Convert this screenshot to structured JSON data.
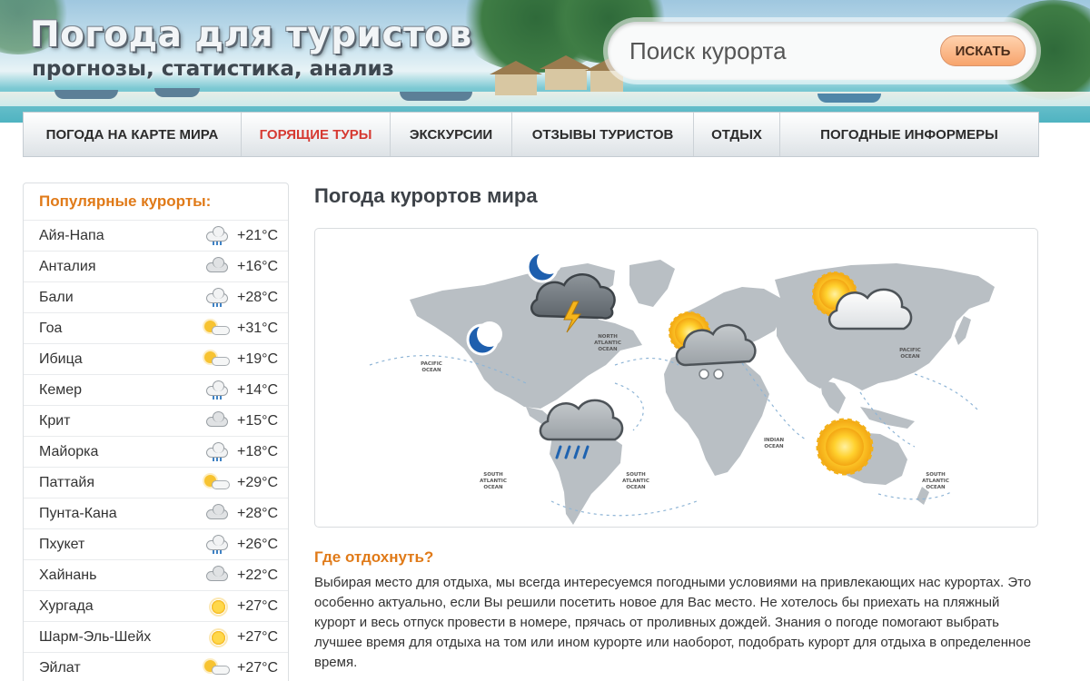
{
  "header": {
    "title": "Погода для туристов",
    "subtitle": "прогнозы, статистика, анализ",
    "search": {
      "placeholder": "Поиск курорта",
      "button_label": "ИСКАТЬ"
    }
  },
  "nav": {
    "items": [
      {
        "label": "ПОГОДА НА КАРТЕ МИРА"
      },
      {
        "label": "ГОРЯЩИЕ ТУРЫ"
      },
      {
        "label": "ЭКСКУРСИИ"
      },
      {
        "label": "ОТЗЫВЫ ТУРИСТОВ"
      },
      {
        "label": "ОТДЫХ"
      },
      {
        "label": "ПОГОДНЫЕ ИНФОРМЕРЫ"
      }
    ]
  },
  "sidebar": {
    "title": "Популярные курорты:",
    "resorts": [
      {
        "name": "Айя-Напа",
        "icon": "cloud-rain-icon",
        "temp": "+21°C"
      },
      {
        "name": "Анталия",
        "icon": "cloud-icon",
        "temp": "+16°C"
      },
      {
        "name": "Бали",
        "icon": "cloud-rain-icon",
        "temp": "+28°C"
      },
      {
        "name": "Гоа",
        "icon": "sun-cloud-icon",
        "temp": "+31°C"
      },
      {
        "name": "Ибица",
        "icon": "sun-cloud-icon",
        "temp": "+19°C"
      },
      {
        "name": "Кемер",
        "icon": "cloud-rain-icon",
        "temp": "+14°C"
      },
      {
        "name": "Крит",
        "icon": "cloud-icon",
        "temp": "+15°C"
      },
      {
        "name": "Майорка",
        "icon": "cloud-rain-icon",
        "temp": "+18°C"
      },
      {
        "name": "Паттайя",
        "icon": "sun-cloud-icon",
        "temp": "+29°C"
      },
      {
        "name": "Пунта-Кана",
        "icon": "cloud-icon",
        "temp": "+28°C"
      },
      {
        "name": "Пхукет",
        "icon": "cloud-rain-icon",
        "temp": "+26°C"
      },
      {
        "name": "Хайнань",
        "icon": "cloud-icon",
        "temp": "+22°C"
      },
      {
        "name": "Хургада",
        "icon": "sun-icon",
        "temp": "+27°C"
      },
      {
        "name": "Шарм-Эль-Шейх",
        "icon": "sun-icon",
        "temp": "+27°C"
      },
      {
        "name": "Эйлат",
        "icon": "sun-cloud-icon",
        "temp": "+27°C"
      }
    ]
  },
  "main": {
    "title": "Погода курортов мира",
    "map": {
      "labels": {
        "pacific_left": [
          "PACIFIC",
          "OCEAN"
        ],
        "north_atlantic": [
          "NORTH",
          "ATLANTIC",
          "OCEAN"
        ],
        "pacific_right": [
          "PACIFIC",
          "OCEAN"
        ],
        "south_atlantic_left": [
          "SOUTH",
          "ATLANTIC",
          "OCEAN"
        ],
        "south_atlantic_mid": [
          "SOUTH",
          "ATLANTIC",
          "OCEAN"
        ],
        "indian": [
          "INDIAN",
          "OCEAN"
        ],
        "south_atlantic_right": [
          "SOUTH",
          "ATLANTIC",
          "OCEAN"
        ]
      }
    },
    "section_title": "Где отдохнуть?",
    "section_text": "Выбирая место для отдыха, мы всегда интересуемся погодными условиями на привлекающих нас курортах. Это особенно актуально, если Вы решили посетить новое для Вас место. Не хотелось бы приехать на пляжный курорт и весь отпуск провести в номере, прячась от проливных дождей. Знания о погоде помогают выбрать лучшее время для отдыха на том или ином курорте или наоборот, подобрать курорт для отдыха в определенное время."
  },
  "colors": {
    "accent_orange": "#e07a18",
    "hot_red": "#d63a32",
    "map_land": "#b9bfc4"
  }
}
